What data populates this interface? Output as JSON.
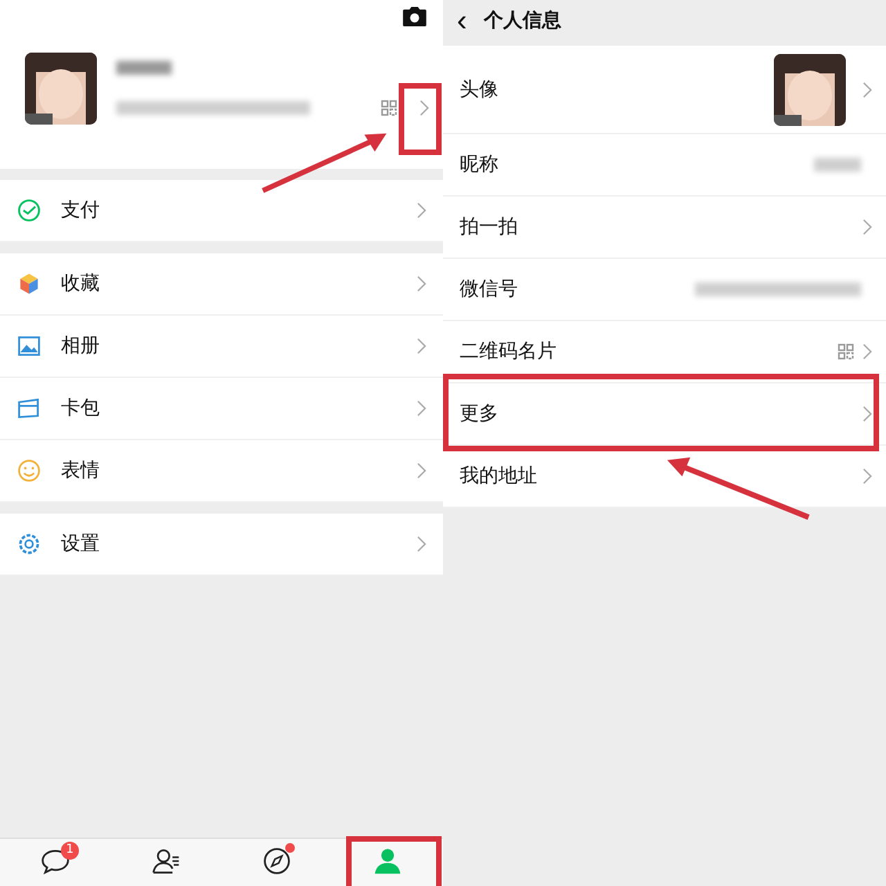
{
  "me_screen": {
    "groups": [
      [
        {
          "label": "支付",
          "kind": "pay"
        }
      ],
      [
        {
          "label": "收藏",
          "kind": "favorites"
        },
        {
          "label": "相册",
          "kind": "album"
        },
        {
          "label": "卡包",
          "kind": "cards"
        },
        {
          "label": "表情",
          "kind": "stickers"
        }
      ],
      [
        {
          "label": "设置",
          "kind": "settings"
        }
      ]
    ],
    "tab_bar": [
      {
        "kind": "chats",
        "badge": "1",
        "selected": false
      },
      {
        "kind": "contacts",
        "selected": false
      },
      {
        "kind": "discover",
        "dot": true,
        "selected": false
      },
      {
        "kind": "me",
        "selected": true
      }
    ]
  },
  "profile_screen": {
    "title": "个人信息",
    "back": "‹",
    "rows": [
      {
        "label": "头像",
        "kind": "avatar"
      },
      {
        "label": "昵称",
        "kind": "redacted"
      },
      {
        "label": "拍一拍",
        "kind": "plain"
      },
      {
        "label": "微信号",
        "kind": "redacted"
      },
      {
        "label": "二维码名片",
        "kind": "qr"
      },
      {
        "label": "更多",
        "kind": "plain"
      },
      {
        "label": "我的地址",
        "kind": "plain"
      }
    ]
  }
}
